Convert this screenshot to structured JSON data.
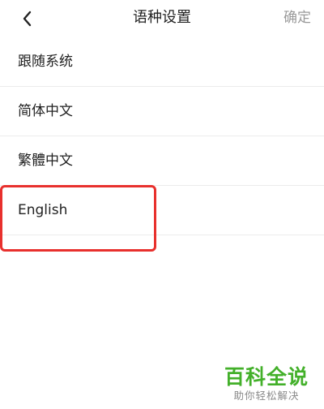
{
  "header": {
    "title": "语种设置",
    "confirm_label": "确定",
    "back_icon": "chevron-left-icon"
  },
  "languages": [
    {
      "label": "跟随系统",
      "selected": false
    },
    {
      "label": "简体中文",
      "selected": false
    },
    {
      "label": "繁體中文",
      "selected": false
    },
    {
      "label": "English",
      "selected": true
    }
  ],
  "annotation": {
    "highlight_color": "#e8302d"
  },
  "watermark": {
    "title": "百科全说",
    "subtitle": "助你轻松解决",
    "color": "#43b02a"
  }
}
